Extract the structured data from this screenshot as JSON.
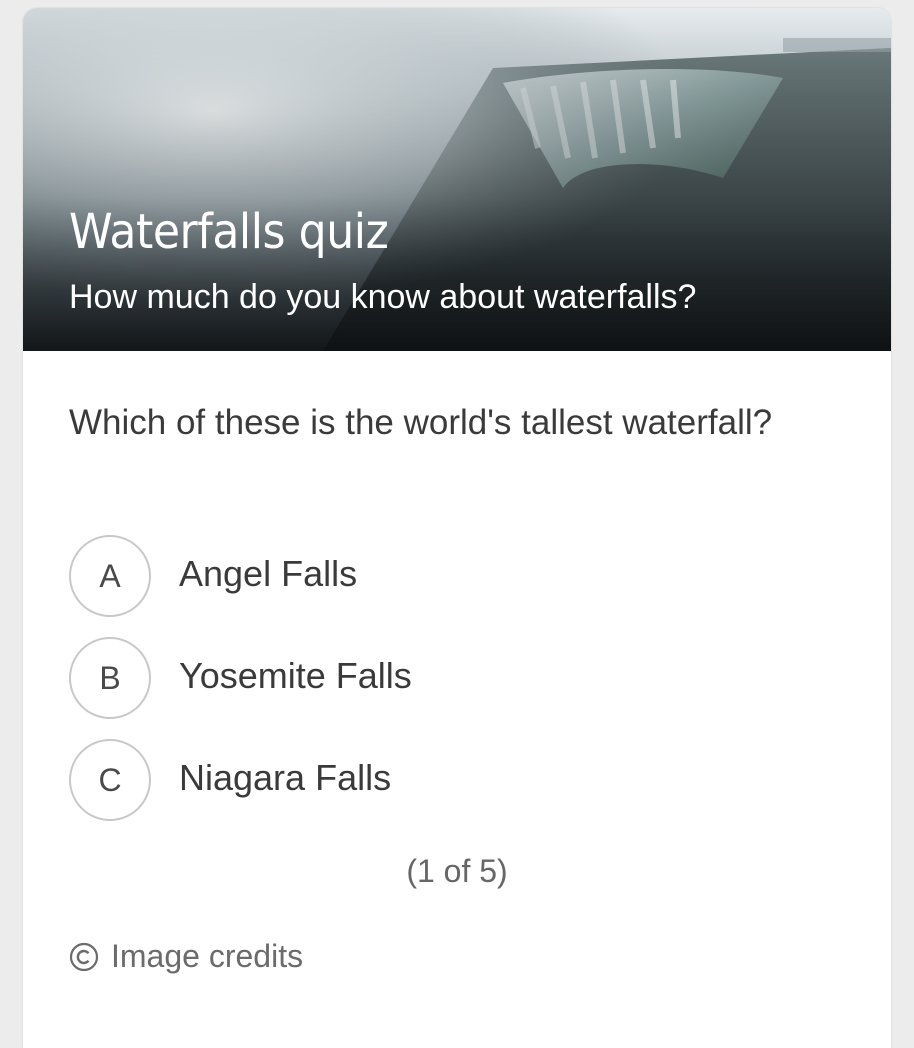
{
  "hero": {
    "title": "Waterfalls quiz",
    "subtitle": "How much do you know about waterfalls?"
  },
  "question": {
    "text": "Which of these is the world's tallest waterfall?"
  },
  "options": [
    {
      "letter": "A",
      "label": "Angel Falls"
    },
    {
      "letter": "B",
      "label": "Yosemite Falls"
    },
    {
      "letter": "C",
      "label": "Niagara Falls"
    }
  ],
  "progress": {
    "text": "(1 of 5)"
  },
  "footer": {
    "credits_label": "Image credits",
    "credits_icon": "copyright-icon"
  },
  "colors": {
    "background": "#ececec",
    "card": "#ffffff",
    "text": "#3a3a3a",
    "muted": "#6b6b6b",
    "border": "#c8c8c8"
  }
}
